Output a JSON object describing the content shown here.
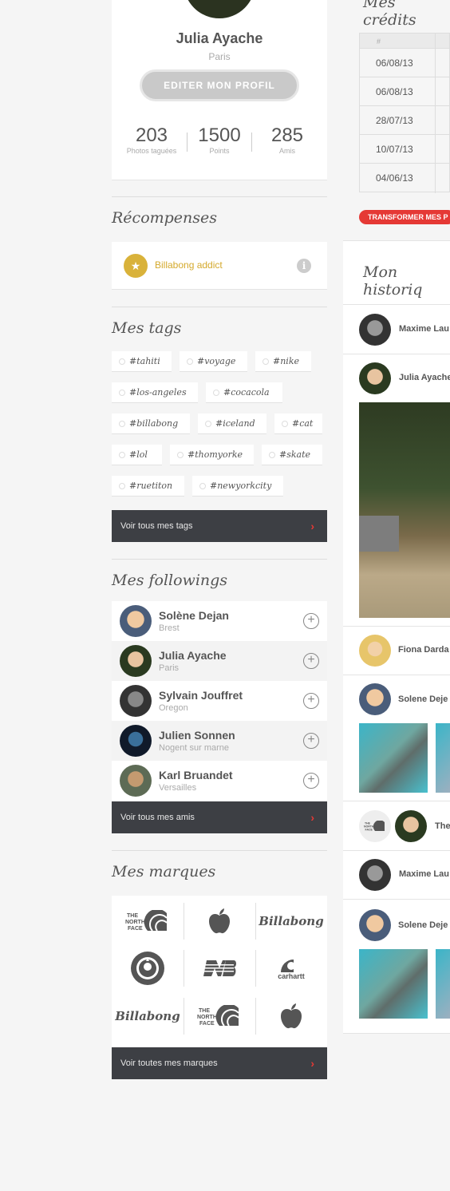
{
  "profile": {
    "name": "Julia Ayache",
    "city": "Paris",
    "edit_button": "EDITER MON PROFIL",
    "stats": [
      {
        "value": "203",
        "label": "Photos taguées"
      },
      {
        "value": "1500",
        "label": "Points"
      },
      {
        "value": "285",
        "label": "Amis"
      }
    ]
  },
  "rewards": {
    "title": "Récompenses",
    "items": [
      {
        "label": "Billabong addict",
        "icon": "star-icon"
      }
    ]
  },
  "tags": {
    "title": "Mes tags",
    "items": [
      "#tahiti",
      "#voyage",
      "#nike",
      "#los-angeles",
      "#cocacola",
      "#billabong",
      "#iceland",
      "#cat",
      "#lol",
      "#thomyorke",
      "#skate",
      "#ruetiton",
      "#newyorkcity"
    ],
    "see_all": "Voir tous mes tags"
  },
  "followings": {
    "title": "Mes followings",
    "items": [
      {
        "name": "Solène Dejan",
        "city": "Brest"
      },
      {
        "name": "Julia Ayache",
        "city": "Paris"
      },
      {
        "name": "Sylvain Jouffret",
        "city": "Oregon"
      },
      {
        "name": "Julien Sonnen",
        "city": "Nogent sur marne"
      },
      {
        "name": "Karl Bruandet",
        "city": "Versailles"
      }
    ],
    "see_all": "Voir tous mes amis"
  },
  "brands": {
    "title": "Mes marques",
    "logos": [
      "the-north-face-logo",
      "apple-logo",
      "billabong-logo",
      "starbucks-logo",
      "new-balance-logo",
      "carhartt-logo",
      "billabong-logo",
      "the-north-face-logo",
      "apple-logo"
    ],
    "tnf_text": "THE NORTH FACE",
    "billabong_text": "Billabong",
    "carhartt_text": "carhartt",
    "see_all": "Voir toutes mes marques"
  },
  "credits": {
    "title": "Mes crédits",
    "header": "#",
    "dates": [
      "06/08/13",
      "06/08/13",
      "28/07/13",
      "10/07/13",
      "04/06/13"
    ],
    "transform_button": "TRANSFORMER MES P"
  },
  "history": {
    "title": "Mon historiq",
    "entries": [
      {
        "name": "Maxime Lau"
      },
      {
        "name": "Julia Ayache"
      },
      {
        "name": "Fiona Darda"
      },
      {
        "name": "Solene Deje"
      },
      {
        "name": "The"
      },
      {
        "name": "Maxime Lau"
      },
      {
        "name": "Solene Deje"
      }
    ]
  },
  "colors": {
    "accent_red": "#e53935",
    "dark_bar": "#3d3f44",
    "gold": "#d4a92c"
  }
}
